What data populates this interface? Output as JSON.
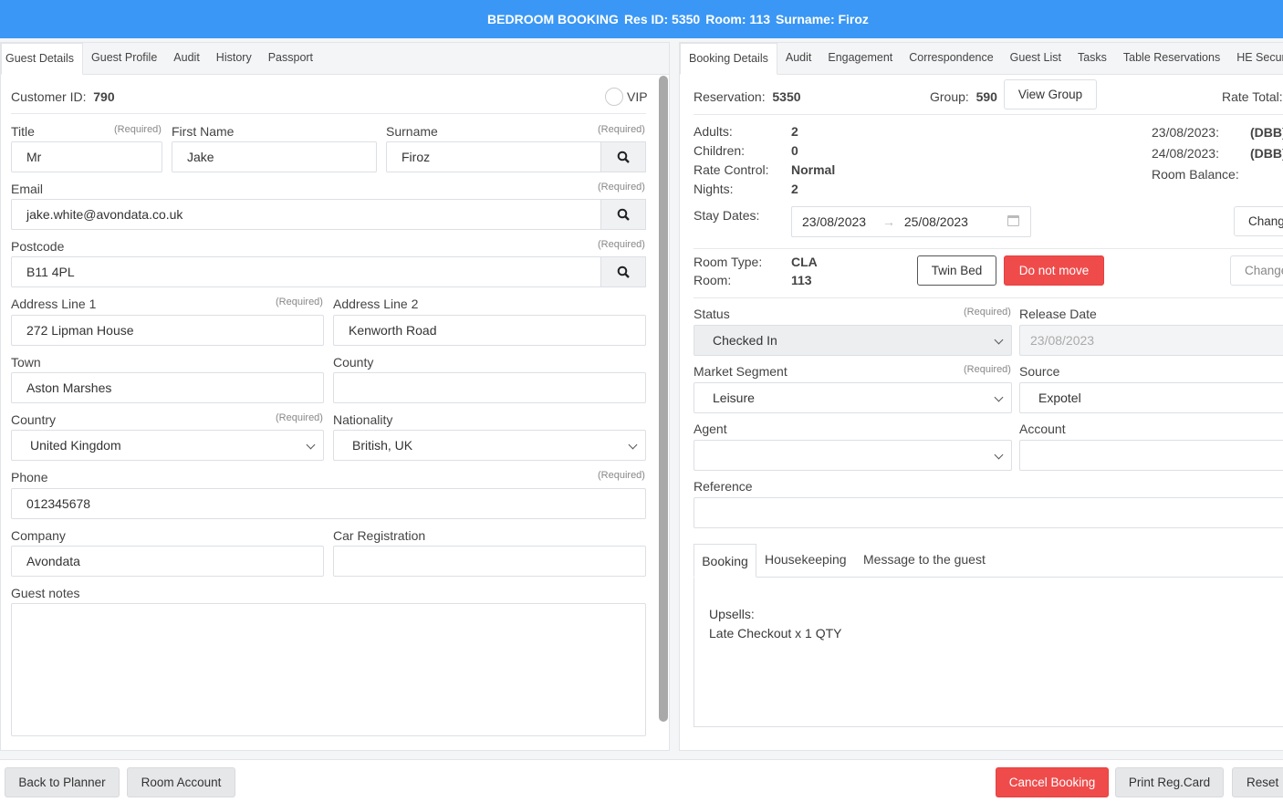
{
  "header": {
    "title": "BEDROOM BOOKING",
    "res_id": "Res ID: 5350",
    "room": "Room: 113",
    "surname": "Surname: Firoz"
  },
  "left_tabs": [
    "Guest Details",
    "Guest Profile",
    "Audit",
    "History",
    "Passport"
  ],
  "guest": {
    "customer_id_label": "Customer ID:",
    "customer_id": "790",
    "vip_label": "VIP",
    "required": "(Required)",
    "title_label": "Title",
    "title": "Mr",
    "first_name_label": "First Name",
    "first_name": "Jake",
    "surname_label": "Surname",
    "surname": "Firoz",
    "email_label": "Email",
    "email": "jake.white@avondata.co.uk",
    "postcode_label": "Postcode",
    "postcode": "B11 4PL",
    "address1_label": "Address Line 1",
    "address1": "272 Lipman House",
    "address2_label": "Address Line 2",
    "address2": "Kenworth Road",
    "town_label": "Town",
    "town": "Aston Marshes",
    "county_label": "County",
    "county": "",
    "country_label": "Country",
    "country": "United Kingdom",
    "nationality_label": "Nationality",
    "nationality": "British, UK",
    "phone_label": "Phone",
    "phone": "012345678",
    "company_label": "Company",
    "company": "Avondata",
    "car_label": "Car Registration",
    "car": "",
    "notes_label": "Guest notes",
    "notes": ""
  },
  "right_tabs": [
    "Booking Details",
    "Audit",
    "Engagement",
    "Correspondence",
    "Guest List",
    "Tasks",
    "Table Reservations",
    "HE Secure"
  ],
  "booking": {
    "reservation_label": "Reservation:",
    "reservation": "5350",
    "group_label": "Group:",
    "group": "590",
    "view_group": "View Group",
    "rate_total_label": "Rate Total:",
    "adults_label": "Adults:",
    "adults": "2",
    "children_label": "Children:",
    "children": "0",
    "rate_control_label": "Rate Control:",
    "rate_control": "Normal",
    "nights_label": "Nights:",
    "nights": "2",
    "rates": [
      {
        "date": "23/08/2023:",
        "plan": "(DBB)"
      },
      {
        "date": "24/08/2023:",
        "plan": "(DBB)"
      }
    ],
    "room_balance_label": "Room Balance:",
    "stay_dates_label": "Stay Dates:",
    "stay_from": "23/08/2023",
    "stay_to": "25/08/2023",
    "change1": "Chang",
    "room_type_label": "Room Type:",
    "room_type": "CLA",
    "room_label": "Room:",
    "room": "113",
    "twin_bed": "Twin Bed",
    "do_not_move": "Do not move",
    "change2": "Change",
    "status_label": "Status",
    "status": "Checked In",
    "required": "(Required)",
    "release_label": "Release Date",
    "release_placeholder": "23/08/2023",
    "market_label": "Market Segment",
    "market": "Leisure",
    "source_label": "Source",
    "source": "Expotel",
    "agent_label": "Agent",
    "agent": "",
    "account_label": "Account",
    "account": "",
    "reference_label": "Reference",
    "reference": "",
    "sub_tabs": [
      "Booking",
      "Housekeeping",
      "Message to the guest"
    ],
    "notes_line1": "Upsells:",
    "notes_line2": "Late Checkout x 1 QTY"
  },
  "footer": {
    "back": "Back to Planner",
    "room_account": "Room Account",
    "cancel": "Cancel Booking",
    "print": "Print Reg.Card",
    "reset": "Reset"
  },
  "colors": {
    "header": "#3a97f5",
    "danger": "#ef4b4b"
  }
}
